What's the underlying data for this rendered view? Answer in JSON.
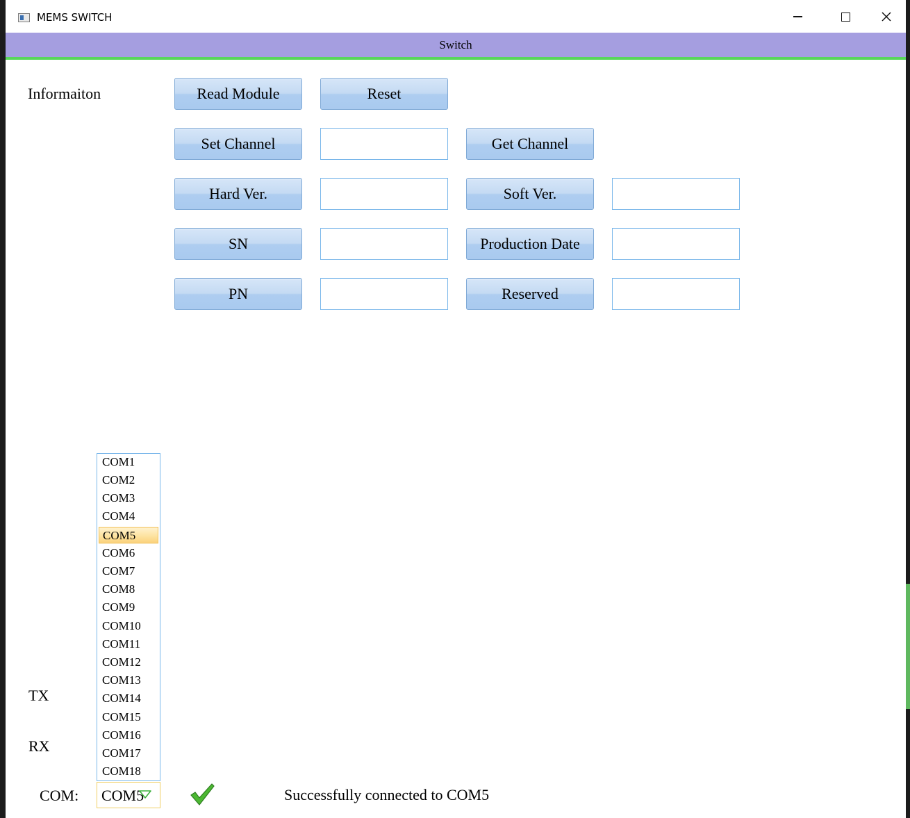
{
  "window": {
    "title": "MEMS SWITCH",
    "controls": [
      "minimize",
      "maximize",
      "close"
    ]
  },
  "tab": {
    "label": "Switch"
  },
  "info": {
    "label": "Informaiton"
  },
  "buttons": {
    "read_module": "Read Module",
    "reset": "Reset",
    "set_channel": "Set Channel",
    "get_channel": "Get Channel",
    "hard_ver": "Hard Ver.",
    "soft_ver": "Soft Ver.",
    "sn": "SN",
    "production_date": "Production Date",
    "pn": "PN",
    "reserved": "Reserved"
  },
  "fields": {
    "set_channel": "",
    "hard_ver": "",
    "soft_ver": "",
    "sn": "",
    "production_date": "",
    "pn": "",
    "reserved": ""
  },
  "side_labels": {
    "tx": "TX",
    "rx": "RX",
    "com": "COM:"
  },
  "com": {
    "selected": "COM5",
    "options": [
      "COM1",
      "COM2",
      "COM3",
      "COM4",
      "COM5",
      "COM6",
      "COM7",
      "COM8",
      "COM9",
      "COM10",
      "COM11",
      "COM12",
      "COM13",
      "COM14",
      "COM15",
      "COM16",
      "COM17",
      "COM18"
    ]
  },
  "status": {
    "icon": "checkmark-icon",
    "message": "Successfully connected to COM5"
  },
  "colors": {
    "tab_band": "#a59ee0",
    "tab_underline": "#59d759",
    "button_fill": "#c4daf3",
    "field_border": "#7ab7ea",
    "selection": "#fde3a1",
    "check": "#3fa52c"
  }
}
